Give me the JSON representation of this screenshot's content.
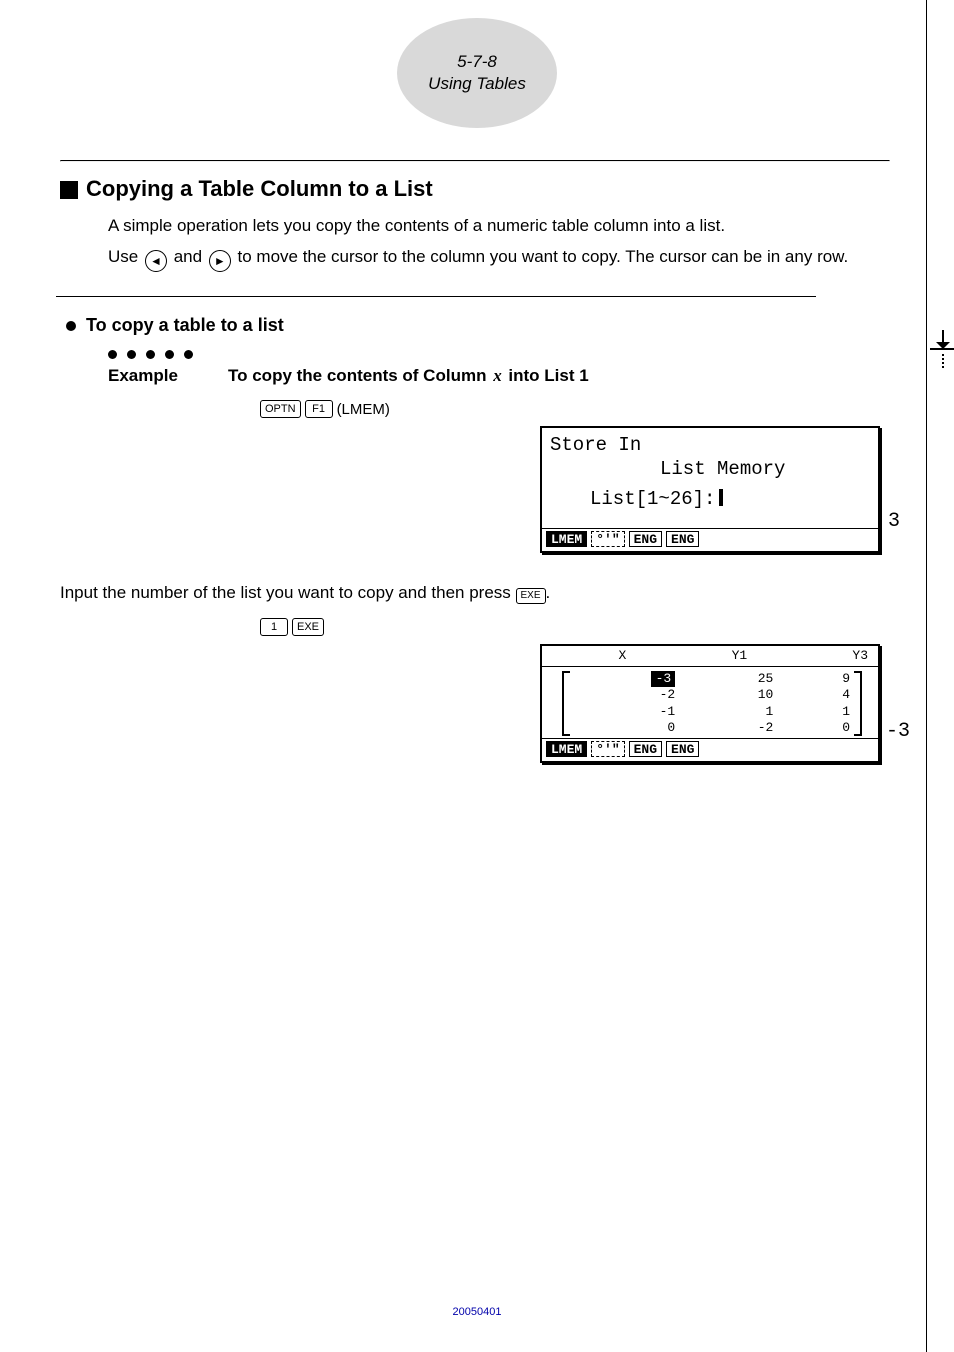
{
  "header": {
    "pagenum": "5-7-8",
    "title": "Using Tables"
  },
  "section": {
    "title": "Copying a Table Column to a List",
    "para1": "A simple operation lets you copy the contents of a numeric table column into a list.",
    "para2_a": "Use ",
    "para2_b": " and ",
    "para2_c": " to move the cursor to the column you want to copy. The cursor can be in any row."
  },
  "sub": {
    "title": "To copy a table to a list",
    "example_label": "Example",
    "example_text_a": "To copy the contents of Column ",
    "example_text_b": " into List 1"
  },
  "keys": {
    "seq1": {
      "k1": "OPTN",
      "k2": "F1",
      "fn": "(LMEM)"
    },
    "seq2": {
      "k1": "1",
      "k2": "EXE"
    }
  },
  "screen1": {
    "line1": "Store In",
    "line2": "List Memory",
    "line3": "List[1~26]:",
    "soft": {
      "s1": "LMEM",
      "s2": "°'\"",
      "s3": "ENG",
      "s4": "ENG"
    },
    "rt": "3"
  },
  "instr2_a": "Input the number of the list you want to copy and then press ",
  "instr2_b": ".",
  "screen2": {
    "headers": [
      "X",
      "Y1",
      "Y3"
    ],
    "rows": [
      [
        "-3",
        "25",
        "9"
      ],
      [
        "-2",
        "10",
        "4"
      ],
      [
        "-1",
        "1",
        "1"
      ],
      [
        "0",
        "-2",
        "0"
      ]
    ],
    "soft": {
      "s1": "LMEM",
      "s2": "°'\"",
      "s3": "ENG",
      "s4": "ENG"
    },
    "rt": "-3"
  },
  "footer": {
    "date": "20050401"
  }
}
